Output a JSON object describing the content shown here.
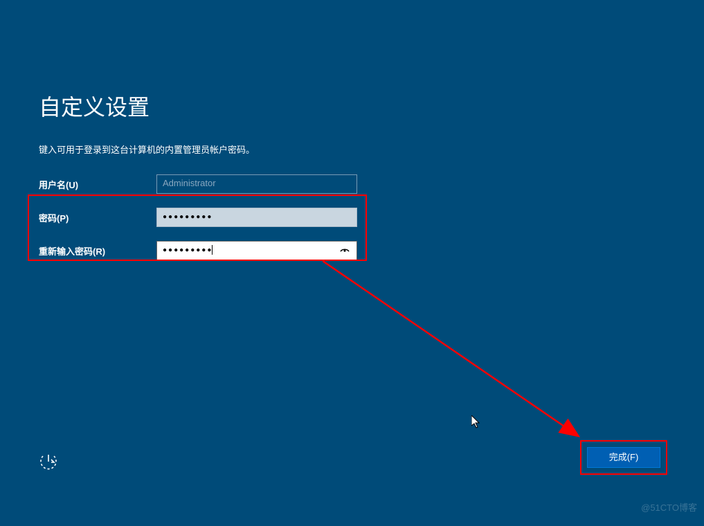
{
  "header": {
    "title": "自定义设置",
    "subtitle": "键入可用于登录到这台计算机的内置管理员帐户密码。"
  },
  "form": {
    "username": {
      "label": "用户名(U)",
      "value": "Administrator"
    },
    "password": {
      "label": "密码(P)",
      "value": "●●●●●●●●●"
    },
    "confirm_password": {
      "label": "重新输入密码(R)",
      "value": "●●●●●●●●●"
    }
  },
  "footer": {
    "finish_button": "完成(F)"
  },
  "watermark": "@51CTO博客"
}
